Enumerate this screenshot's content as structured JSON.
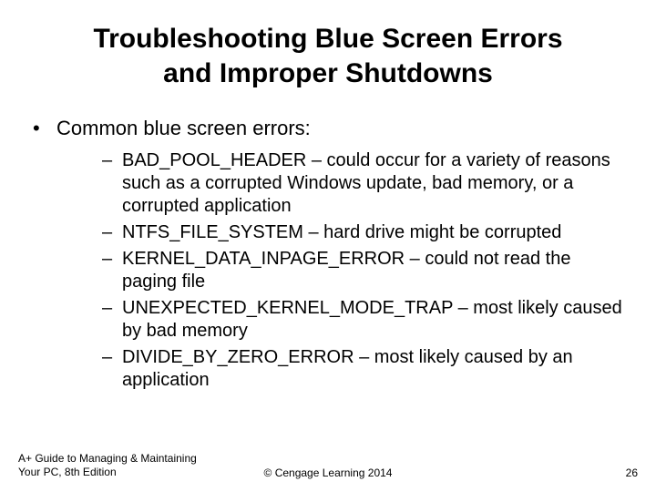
{
  "title_line1": "Troubleshooting Blue Screen Errors",
  "title_line2": "and Improper Shutdowns",
  "bullet_main": "Common blue screen errors:",
  "sub_items": [
    "BAD_POOL_HEADER – could occur for a variety of reasons such as a corrupted Windows update, bad memory, or a corrupted application",
    "NTFS_FILE_SYSTEM – hard drive might be corrupted",
    "KERNEL_DATA_INPAGE_ERROR – could not read the paging file",
    "UNEXPECTED_KERNEL_MODE_TRAP – most likely caused by bad memory",
    "DIVIDE_BY_ZERO_ERROR – most likely caused by an application"
  ],
  "footer": {
    "left": "A+ Guide to Managing & Maintaining Your PC, 8th Edition",
    "center": "© Cengage Learning  2014",
    "page": "26"
  }
}
